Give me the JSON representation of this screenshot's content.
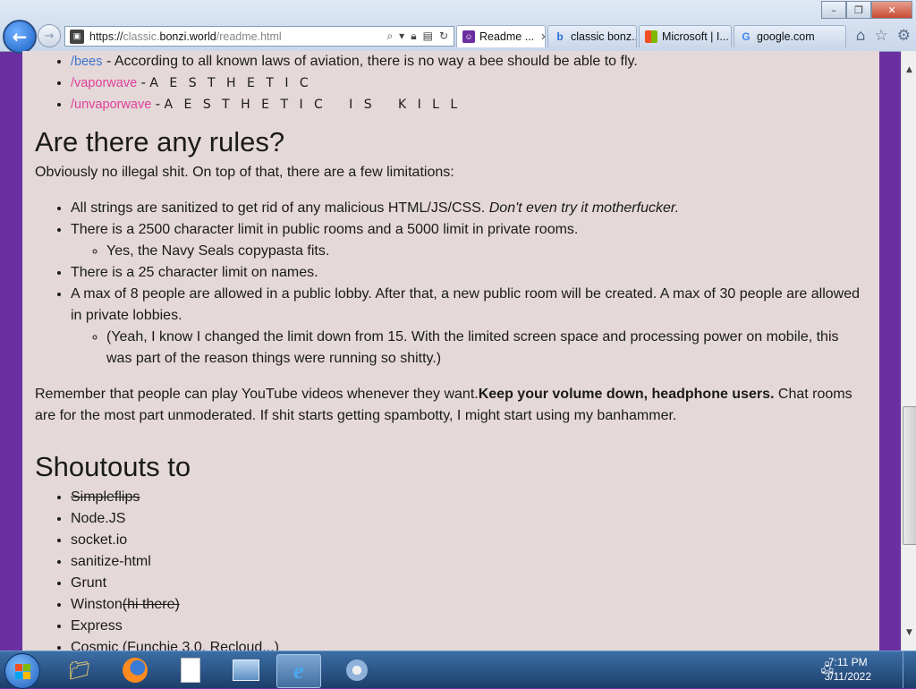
{
  "browser": {
    "url": {
      "scheme": "https://",
      "host_pre": "classic.",
      "host": "bonzi.world",
      "path": "/readme.html"
    },
    "tabs": [
      {
        "label": "Readme ...",
        "active": true
      },
      {
        "label": "classic bonz...",
        "active": false
      },
      {
        "label": "Microsoft | I...",
        "active": false
      },
      {
        "label": "google.com",
        "active": false
      }
    ]
  },
  "page": {
    "commands": [
      {
        "cmd": "/bees",
        "desc": "- According to all known laws of aviation, there is no way a bee should be able to fly."
      },
      {
        "cmd": "/vaporwave",
        "desc": "- ",
        "aesthetic": "A E S T H E T I C"
      },
      {
        "cmd": "/unvaporwave",
        "desc": "- ",
        "aesthetic": "A E S T H E T I C   I S   K I L L"
      }
    ],
    "rules": {
      "heading": "Are there any rules?",
      "intro": "Obviously no illegal shit. On top of that, there are a few limitations:",
      "item1_plain": "All strings are sanitized to get rid of any malicious HTML/JS/CSS. ",
      "item1_em": "Don't even try it motherfucker.",
      "item2": "There is a 2500 character limit in public rooms and a 5000 limit in private rooms.",
      "item2_sub": "Yes, the Navy Seals copypasta fits.",
      "item3": "There is a 25 character limit on names.",
      "item4": "A max of 8 people are allowed in a public lobby. After that, a new public room will be created. A max of 30 people are allowed in private lobbies.",
      "item4_sub": "(Yeah, I know I changed the limit down from 15. With the limited screen space and processing power on mobile, this was part of the reason things were running so shitty.)",
      "remember_plain": "Remember that people can play YouTube videos whenever they want.",
      "remember_bold": "Keep your volume down, headphone users.",
      "remember_rest": " Chat rooms are for the most part unmoderated. If shit starts getting spambotty, I might start using my banhammer."
    },
    "shoutouts": {
      "heading": "Shoutouts to",
      "items": [
        "Simpleflips",
        "Node.JS",
        "socket.io",
        "sanitize-html",
        "Grunt",
        "Winston",
        "Express",
        "Cosmic (Funchie 3.0, Recloud...)"
      ],
      "winston_note": "(hi there)"
    }
  },
  "taskbar": {
    "time": "7:11 PM",
    "date": "3/11/2022"
  }
}
